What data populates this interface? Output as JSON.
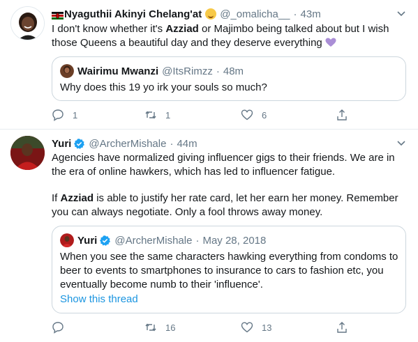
{
  "tweets": [
    {
      "author_name": "Nyaguthii Akinyi Chelang'at",
      "handle": "@_omalicha__",
      "separator": "·",
      "time": "43m",
      "text_part1": "I don't know whether it's ",
      "text_bold": "Azziad",
      "text_part2": " or Majimbo being talked about but I wish those Queens a beautiful day and they deserve everything",
      "quote": {
        "author_name": "Wairimu Mwanzi",
        "handle": "@ItsRimzz",
        "separator": "·",
        "time": "48m",
        "text": "Why does this 19 yo irk your souls so much?"
      },
      "actions": {
        "replies": "1",
        "retweets": "1",
        "likes": "6"
      }
    },
    {
      "author_name": "Yuri",
      "handle": "@ArcherMishale",
      "separator": "·",
      "time": "44m",
      "para1": "Agencies have normalized giving influencer gigs to their friends. We are in the era of online hawkers, which has led to influencer fatigue.",
      "para2_part1": "If ",
      "para2_bold": "Azziad",
      "para2_part2": " is able to justify her rate card, let her earn her money. Remember you can always negotiate. Only a fool throws away money.",
      "quote": {
        "author_name": "Yuri",
        "handle": "@ArcherMishale",
        "separator": "·",
        "time": "May 28, 2018",
        "text": "When you see the same characters hawking everything from condoms to beer to events to smartphones to insurance to cars to fashion etc, you eventually become numb to their 'influence'.",
        "show_thread": "Show this thread"
      },
      "actions": {
        "replies": "",
        "retweets": "16",
        "likes": "13"
      }
    }
  ],
  "colors": {
    "text": "#14171a",
    "muted": "#657786",
    "link": "#1b95e0",
    "border": "#e6ecf0",
    "verified": "#1da1f2",
    "heart_emoji": "#aa8ed6"
  },
  "icons": [
    "kenya-flag-icon",
    "smiling-face-icon",
    "purple-heart-icon",
    "verified-badge-icon",
    "chevron-down-icon",
    "reply-icon",
    "retweet-icon",
    "like-icon",
    "share-icon"
  ]
}
